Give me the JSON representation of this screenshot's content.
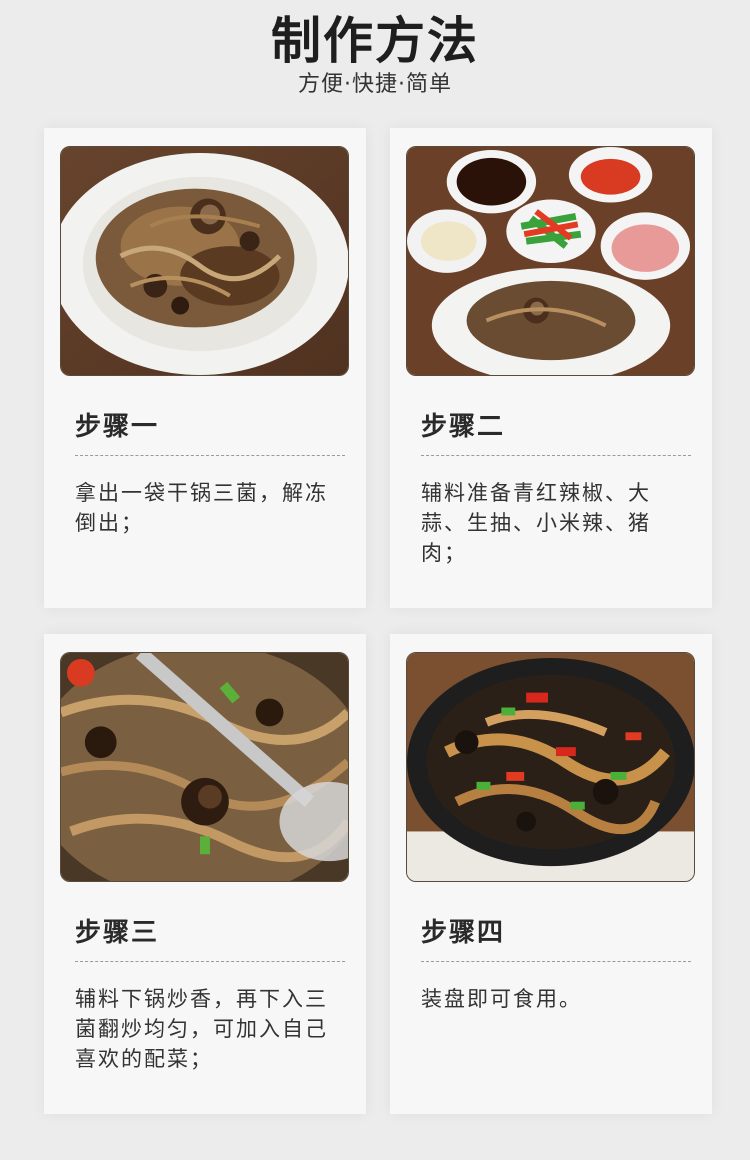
{
  "header": {
    "title": "制作方法",
    "subtitle": "方便·快捷·简单"
  },
  "steps": [
    {
      "label": "步骤一",
      "desc": "拿出一袋干锅三菌，解冻倒出；",
      "image": "plate-of-mushrooms"
    },
    {
      "label": "步骤二",
      "desc": "辅料准备青红辣椒、大蒜、生抽、小米辣、猪肉；",
      "image": "ingredients-bowls"
    },
    {
      "label": "步骤三",
      "desc": "辅料下锅炒香，再下入三菌翻炒均匀，可加入自己喜欢的配菜；",
      "image": "stir-frying-in-wok"
    },
    {
      "label": "步骤四",
      "desc": "装盘即可食用。",
      "image": "finished-dish-in-pan"
    }
  ]
}
